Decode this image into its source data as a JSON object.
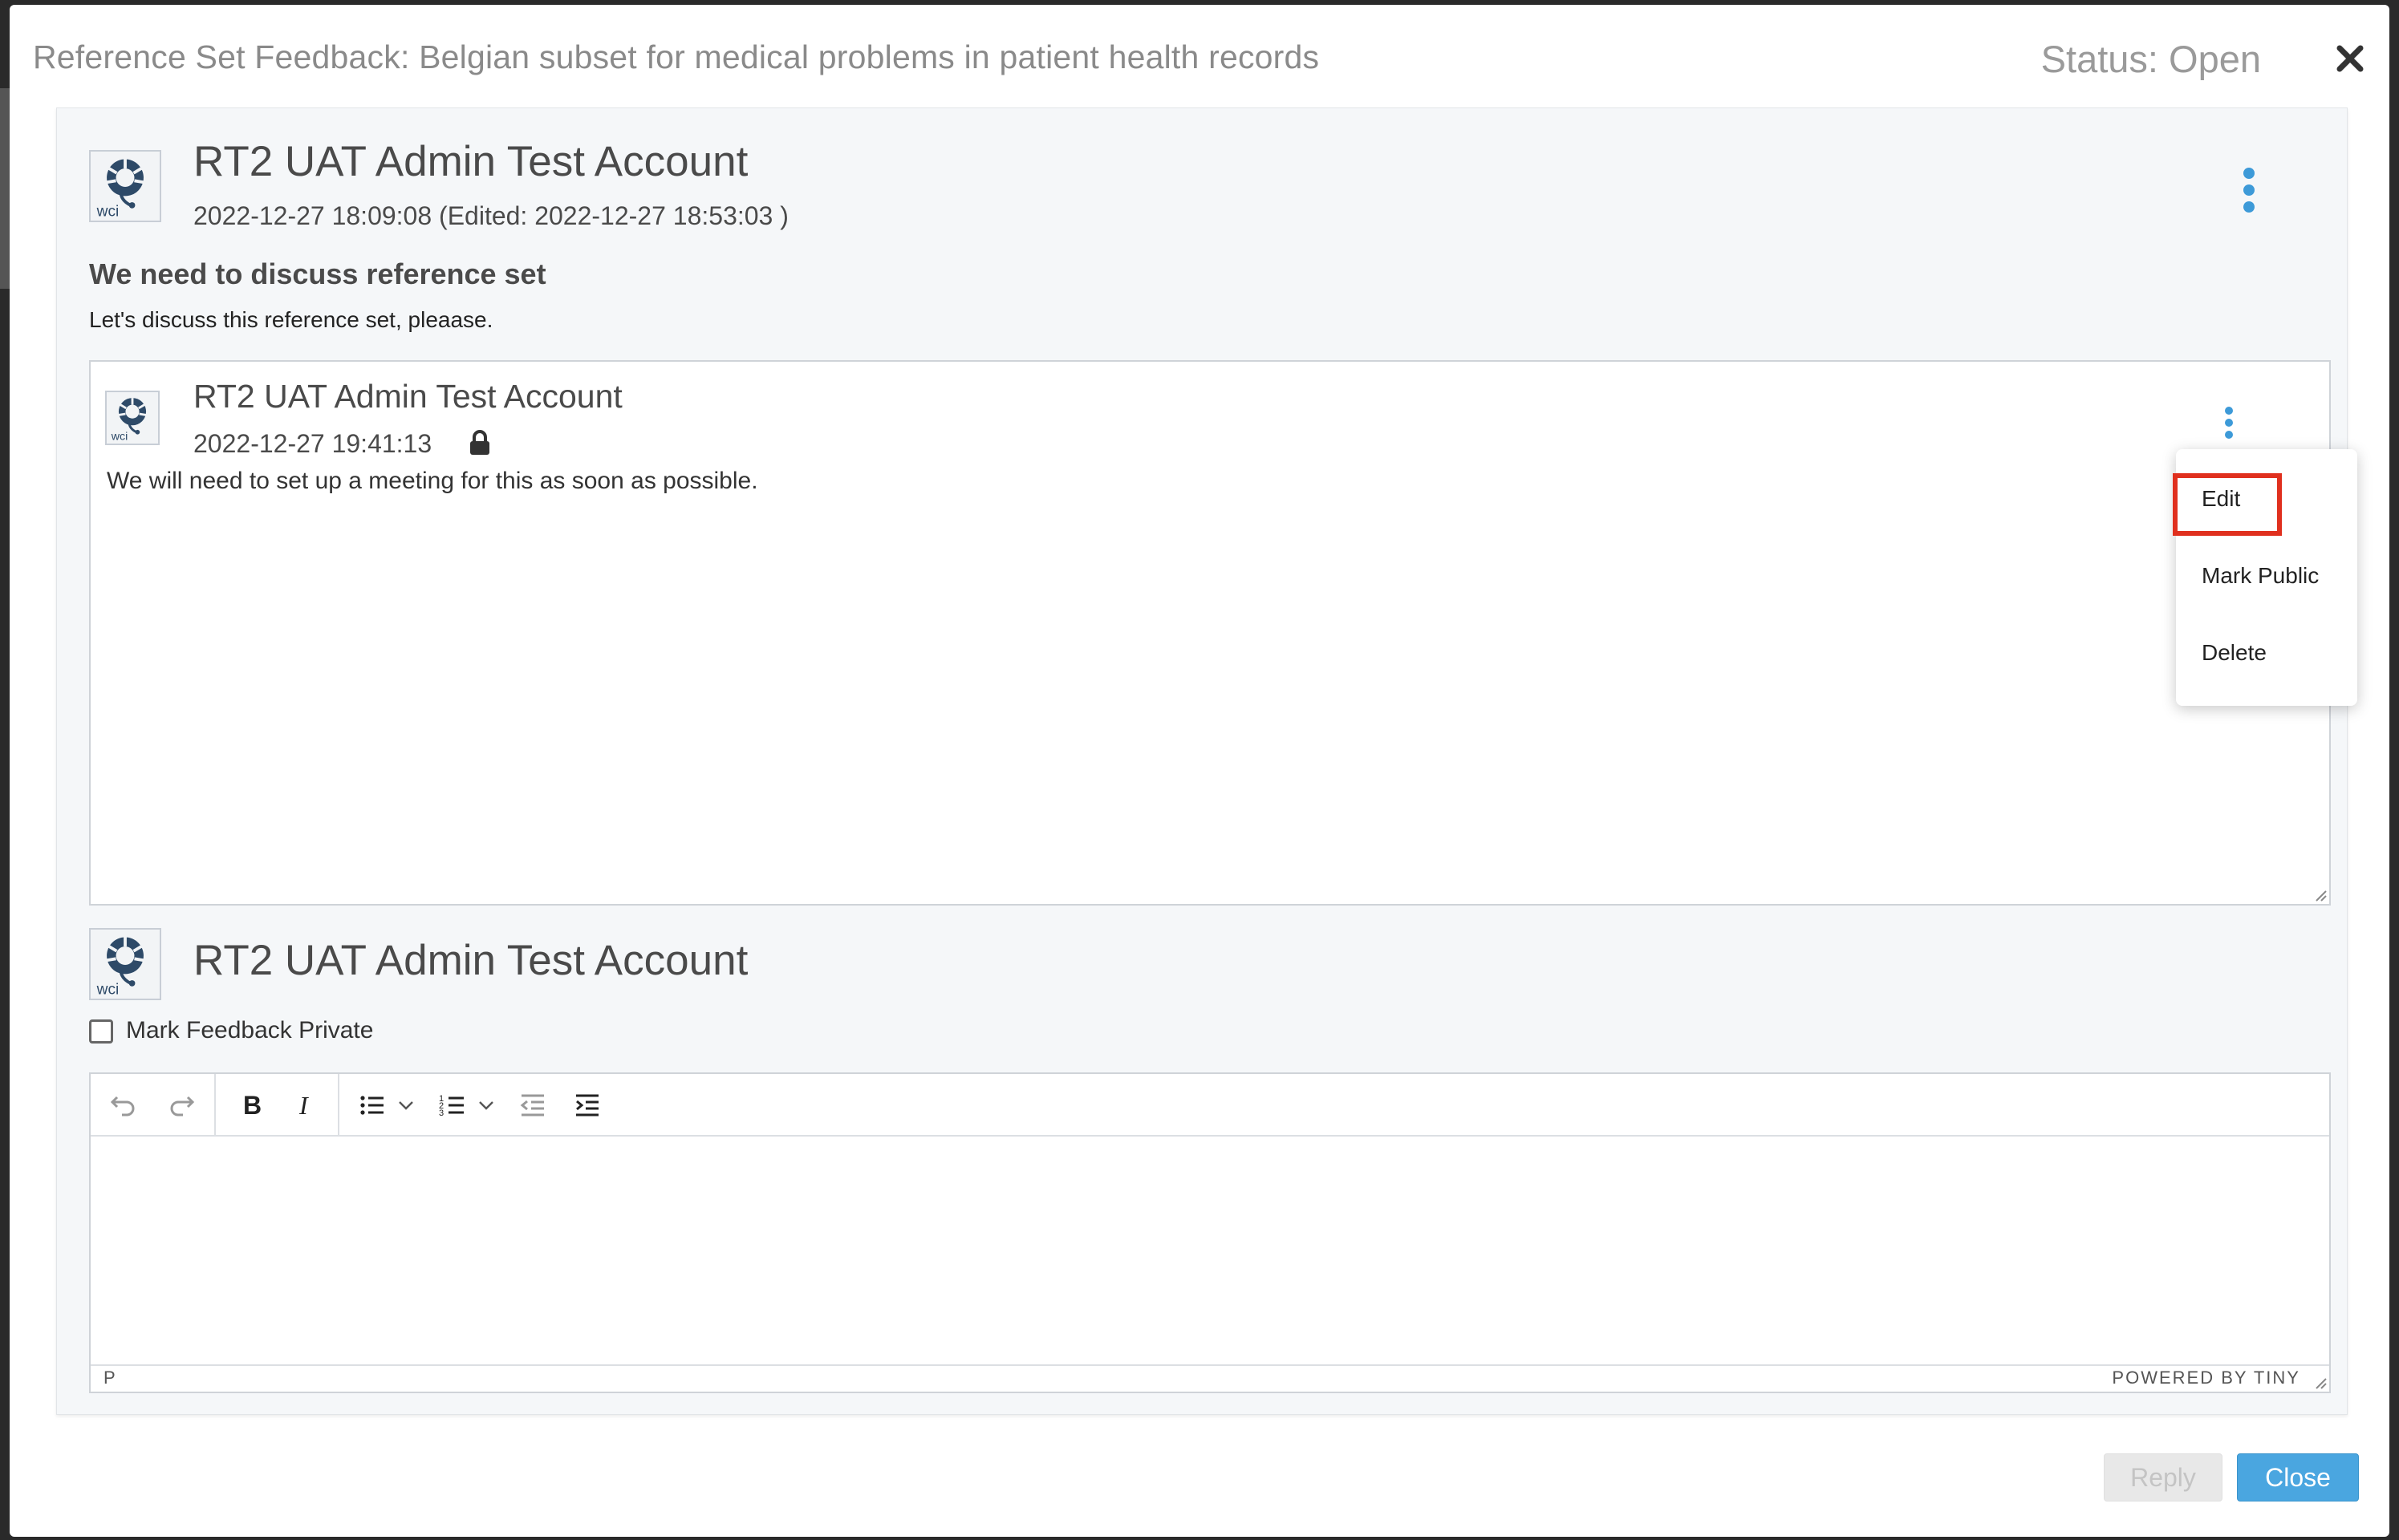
{
  "modal": {
    "title": "Reference Set Feedback: Belgian subset for medical problems in patient health records",
    "status": "Status: Open"
  },
  "feedback": {
    "author": "RT2 UAT Admin Test Account",
    "timestamp": "2022-12-27 18:09:08 (Edited: 2022-12-27 18:53:03 )",
    "subject": "We need to discuss reference set",
    "body": "Let's discuss this reference set, pleaase."
  },
  "reply": {
    "author": "RT2 UAT Admin Test Account",
    "timestamp": "2022-12-27 19:41:13",
    "body": "We will need to set up a meeting for this as soon as possible."
  },
  "reply_menu": {
    "items": [
      "Edit",
      "Mark Public",
      "Delete"
    ],
    "highlighted": "Edit"
  },
  "compose": {
    "author": "RT2 UAT Admin Test Account",
    "private_label": "Mark Feedback Private",
    "private_checked": false,
    "editor_path": "P",
    "powered_by": "POWERED BY TINY"
  },
  "avatar_text": "wci",
  "footer": {
    "reply_label": "Reply",
    "close_label": "Close"
  },
  "colors": {
    "accent": "#4aa6e0",
    "kebab": "#3d9ad8",
    "highlight": "#e0301e"
  }
}
